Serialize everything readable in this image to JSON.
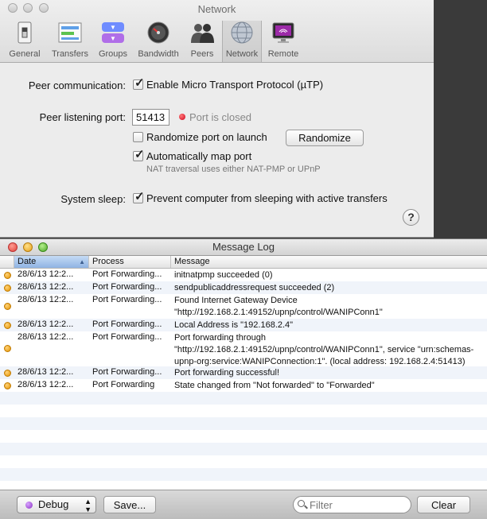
{
  "prefs": {
    "title": "Network",
    "toolbar": [
      {
        "label": "General",
        "icon": "switch-icon"
      },
      {
        "label": "Transfers",
        "icon": "transfers-icon"
      },
      {
        "label": "Groups",
        "icon": "groups-icon"
      },
      {
        "label": "Bandwidth",
        "icon": "speedometer-icon"
      },
      {
        "label": "Peers",
        "icon": "peers-icon"
      },
      {
        "label": "Network",
        "icon": "globe-icon",
        "selected": true
      },
      {
        "label": "Remote",
        "icon": "remote-icon"
      }
    ],
    "peer_comm_label": "Peer communication:",
    "utp_label": "Enable Micro Transport Protocol (µTP)",
    "utp_checked": true,
    "port_label": "Peer listening port:",
    "port_value": "51413",
    "port_status": "Port is closed",
    "port_status_color": "#d0021b",
    "randomize_launch_label": "Randomize port on launch",
    "randomize_launch_checked": false,
    "randomize_button": "Randomize",
    "auto_map_label": "Automatically map port",
    "auto_map_checked": true,
    "nat_note": "NAT traversal uses either NAT-PMP or UPnP",
    "sleep_label": "System sleep:",
    "sleep_option": "Prevent computer from sleeping with active transfers",
    "sleep_checked": true,
    "help": "?"
  },
  "log": {
    "title": "Message Log",
    "columns": {
      "date": "Date",
      "process": "Process",
      "message": "Message"
    },
    "rows": [
      {
        "date": "28/6/13 12:2...",
        "process": "Port Forwarding...",
        "message": "initnatpmp succeeded (0)"
      },
      {
        "date": "28/6/13 12:2...",
        "process": "Port Forwarding...",
        "message": "sendpublicaddressrequest succeeded (2)"
      },
      {
        "date": "28/6/13 12:2...",
        "process": "Port Forwarding...",
        "message": "Found Internet Gateway Device \"http://192.168.2.1:49152/upnp/control/WANIPConn1\""
      },
      {
        "date": "28/6/13 12:2...",
        "process": "Port Forwarding...",
        "message": "Local Address is \"192.168.2.4\""
      },
      {
        "date": "28/6/13 12:2...",
        "process": "Port Forwarding...",
        "message": "Port forwarding through \"http://192.168.2.1:49152/upnp/control/WANIPConn1\", service \"urn:schemas-upnp-org:service:WANIPConnection:1\". (local address: 192.168.2.4:51413)"
      },
      {
        "date": "28/6/13 12:2...",
        "process": "Port Forwarding...",
        "message": "Port forwarding successful!"
      },
      {
        "date": "28/6/13 12:2...",
        "process": "Port Forwarding",
        "message": "State changed from \"Not forwarded\" to \"Forwarded\""
      }
    ],
    "level": "Debug",
    "save_button": "Save...",
    "filter_placeholder": "Filter",
    "clear_button": "Clear"
  }
}
